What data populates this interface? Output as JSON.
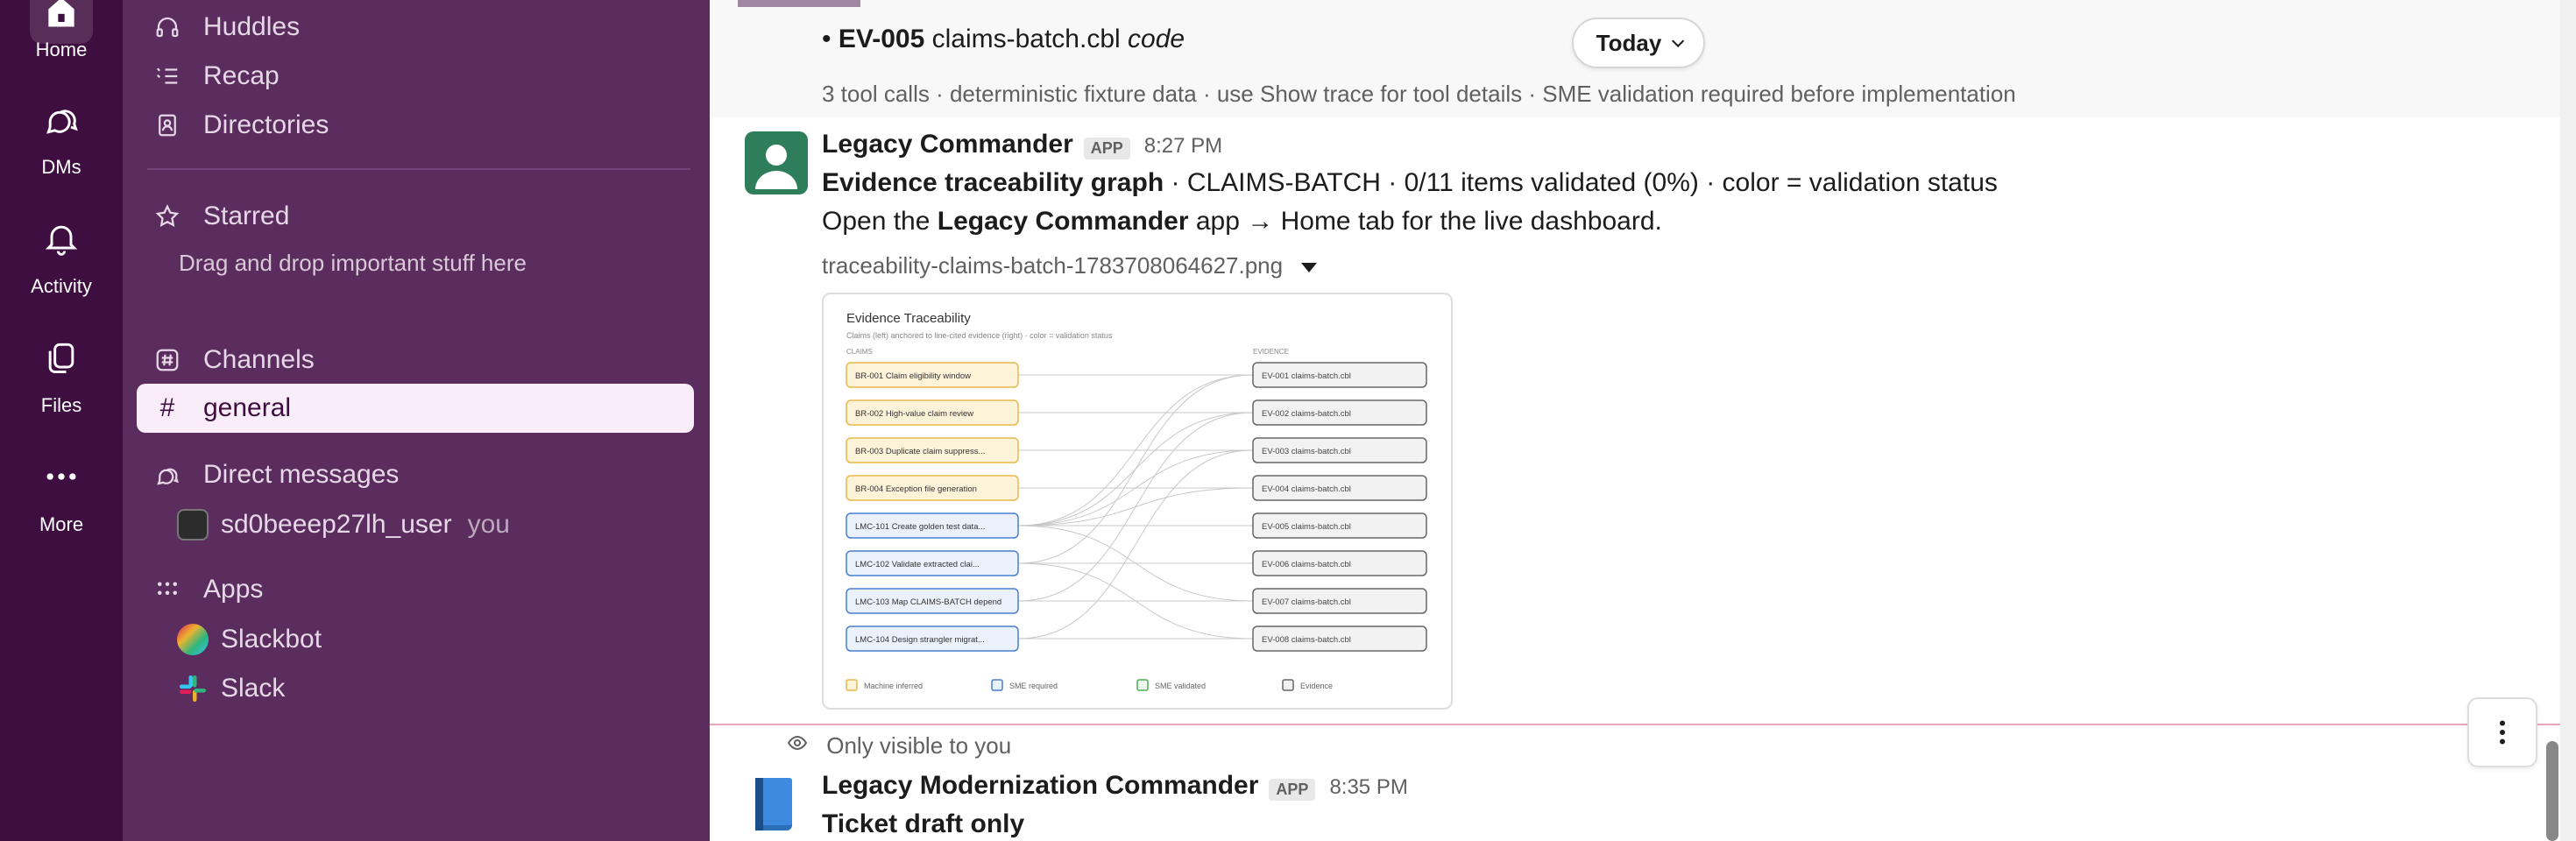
{
  "rail": {
    "home": "Home",
    "dms": "DMs",
    "activity": "Activity",
    "files": "Files",
    "more": "More"
  },
  "sidebar": {
    "huddles": "Huddles",
    "recap": "Recap",
    "directories": "Directories",
    "starred": "Starred",
    "starred_hint": "Drag and drop important stuff here",
    "channels": "Channels",
    "channel_general": "general",
    "direct_messages": "Direct messages",
    "dm_user": "sd0beeep27lh_user",
    "dm_you": "you",
    "apps": "Apps",
    "app_slackbot": "Slackbot",
    "app_slack": "Slack"
  },
  "messages": {
    "prev_line_1_bold": "EV-005",
    "prev_line_1_file": "claims-batch.cbl",
    "prev_line_1_code": "code",
    "prev_meta": "3 tool calls · deterministic fixture data · use Show trace for tool details · SME validation required before implementation",
    "today": "Today",
    "m1_sender": "Legacy Commander",
    "m1_badge": "APP",
    "m1_time": "8:27 PM",
    "m1_line1_bold": "Evidence traceability graph",
    "m1_line1_rest": " · CLAIMS-BATCH · 0/11 items validated (0%) · color = validation status",
    "m1_line2_pre": "Open the ",
    "m1_line2_bold": "Legacy Commander",
    "m1_line2_post": " app → Home tab for the live dashboard.",
    "m1_file": "traceability-claims-batch-1783708064627.png",
    "visible_note": "Only visible to you",
    "m2_sender": "Legacy Modernization Commander",
    "m2_badge": "APP",
    "m2_time": "8:35 PM",
    "m2_line1": "Ticket draft only"
  },
  "graph": {
    "title": "Evidence Traceability",
    "subtitle": "Claims (left) anchored to line-cited evidence (right) · color = validation status",
    "claims_header": "CLAIMS",
    "evidence_header": "EVIDENCE",
    "claims": [
      {
        "label": "BR-001 Claim eligibility window",
        "status": "machine"
      },
      {
        "label": "BR-002 High-value claim review",
        "status": "machine"
      },
      {
        "label": "BR-003 Duplicate claim suppress...",
        "status": "machine"
      },
      {
        "label": "BR-004 Exception file generation",
        "status": "machine"
      },
      {
        "label": "LMC-101 Create golden test data...",
        "status": "sme"
      },
      {
        "label": "LMC-102 Validate extracted clai...",
        "status": "sme"
      },
      {
        "label": "LMC-103 Map CLAIMS-BATCH depend",
        "status": "sme"
      },
      {
        "label": "LMC-104 Design strangler migrat...",
        "status": "sme"
      }
    ],
    "evidence": [
      "EV-001 claims-batch.cbl",
      "EV-002 claims-batch.cbl",
      "EV-003 claims-batch.cbl",
      "EV-004 claims-batch.cbl",
      "EV-005 claims-batch.cbl",
      "EV-006 claims-batch.cbl",
      "EV-007 claims-batch.cbl",
      "EV-008 claims-batch.cbl"
    ],
    "legend": {
      "machine": "Machine inferred",
      "sme_required": "SME required",
      "sme_validated": "SME validated",
      "evidence": "Evidence"
    },
    "colors": {
      "machine_fill": "#fdf3d9",
      "machine_stroke": "#e8b84a",
      "sme_fill": "#eaf1fb",
      "sme_stroke": "#4a7fd0",
      "validated_stroke": "#4caf50",
      "evidence_fill": "#f2f2f2",
      "evidence_stroke": "#666666"
    }
  }
}
